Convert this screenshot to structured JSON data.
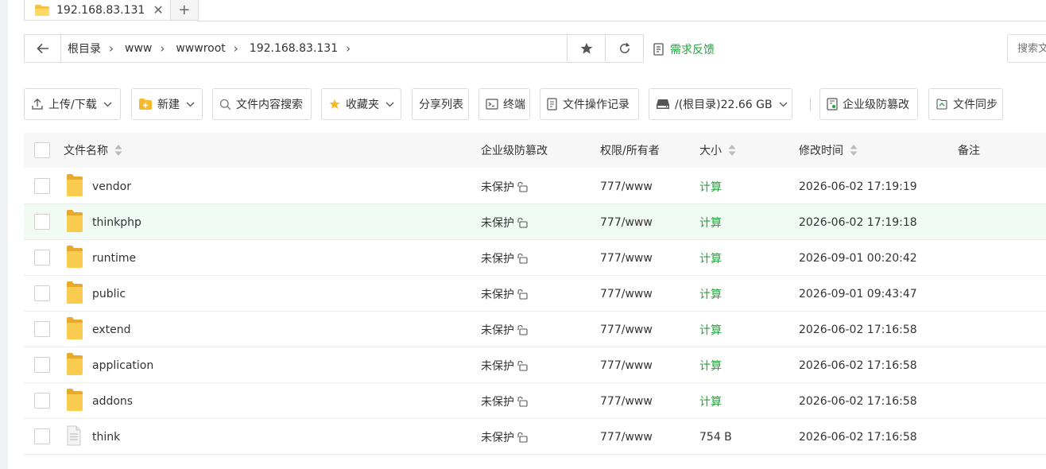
{
  "tabs": [
    {
      "label": "192.168.83.131",
      "close": "✕"
    }
  ],
  "tab_add": "+",
  "breadcrumb": [
    "根目录",
    "www",
    "wwwroot",
    "192.168.83.131"
  ],
  "feedback": "需求反馈",
  "search_placeholder": "搜索文件",
  "toolbar": {
    "upload": "上传/下载",
    "new": "新建",
    "content_search": "文件内容搜索",
    "favorites": "收藏夹",
    "share_list": "分享列表",
    "terminal": "终端",
    "op_log": "文件操作记录",
    "disk": "/(根目录)22.66 GB",
    "tamper": "企业级防篡改",
    "sync": "文件同步"
  },
  "columns": {
    "name": "文件名称",
    "protect": "企业级防篡改",
    "perm": "权限/所有者",
    "size": "大小",
    "mtime": "修改时间",
    "note": "备注"
  },
  "rows": [
    {
      "name": "vendor",
      "type": "folder",
      "protect": "未保护",
      "perm": "777/www",
      "size": "计算",
      "mtime": "2026-06-02 17:19:19"
    },
    {
      "name": "thinkphp",
      "type": "folder",
      "protect": "未保护",
      "perm": "777/www",
      "size": "计算",
      "mtime": "2026-06-02 17:19:18"
    },
    {
      "name": "runtime",
      "type": "folder",
      "protect": "未保护",
      "perm": "777/www",
      "size": "计算",
      "mtime": "2026-09-01 00:20:42"
    },
    {
      "name": "public",
      "type": "folder",
      "protect": "未保护",
      "perm": "777/www",
      "size": "计算",
      "mtime": "2026-09-01 09:43:47"
    },
    {
      "name": "extend",
      "type": "folder",
      "protect": "未保护",
      "perm": "777/www",
      "size": "计算",
      "mtime": "2026-06-02 17:16:58"
    },
    {
      "name": "application",
      "type": "folder",
      "protect": "未保护",
      "perm": "777/www",
      "size": "计算",
      "mtime": "2026-06-02 17:16:58"
    },
    {
      "name": "addons",
      "type": "folder",
      "protect": "未保护",
      "perm": "777/www",
      "size": "计算",
      "mtime": "2026-06-02 17:16:58"
    },
    {
      "name": "think",
      "type": "file",
      "protect": "未保护",
      "perm": "777/www",
      "size": "754 B",
      "mtime": "2026-06-02 17:16:58"
    }
  ],
  "colors": {
    "accent": "#20a53a",
    "folder": "#f5c34a",
    "highlight_row": "#f2faf4"
  }
}
